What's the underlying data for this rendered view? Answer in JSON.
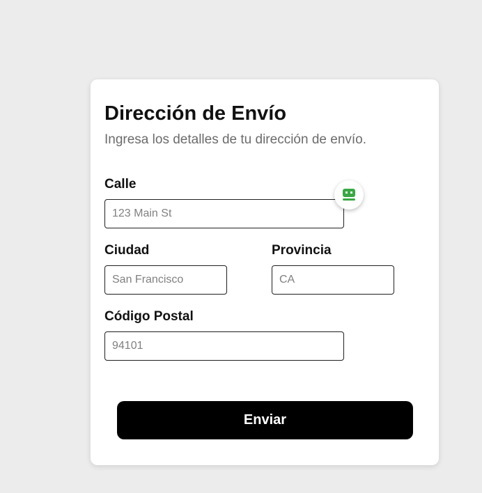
{
  "form": {
    "title": "Dirección de Envío",
    "subtitle": "Ingresa los detalles de tu dirección de envío.",
    "fields": {
      "street": {
        "label": "Calle",
        "placeholder": "123 Main St",
        "value": ""
      },
      "city": {
        "label": "Ciudad",
        "placeholder": "San Francisco",
        "value": ""
      },
      "state": {
        "label": "Provincia",
        "placeholder": "CA",
        "value": ""
      },
      "zip": {
        "label": "Código Postal",
        "placeholder": "94101",
        "value": ""
      }
    },
    "submit_label": "Enviar"
  },
  "helper_badge": {
    "icon": "password-manager-icon",
    "color": "#3aa745"
  },
  "colors": {
    "background": "#ececec",
    "card": "#ffffff",
    "button": "#000000",
    "subtitle": "#6b6b6b"
  }
}
